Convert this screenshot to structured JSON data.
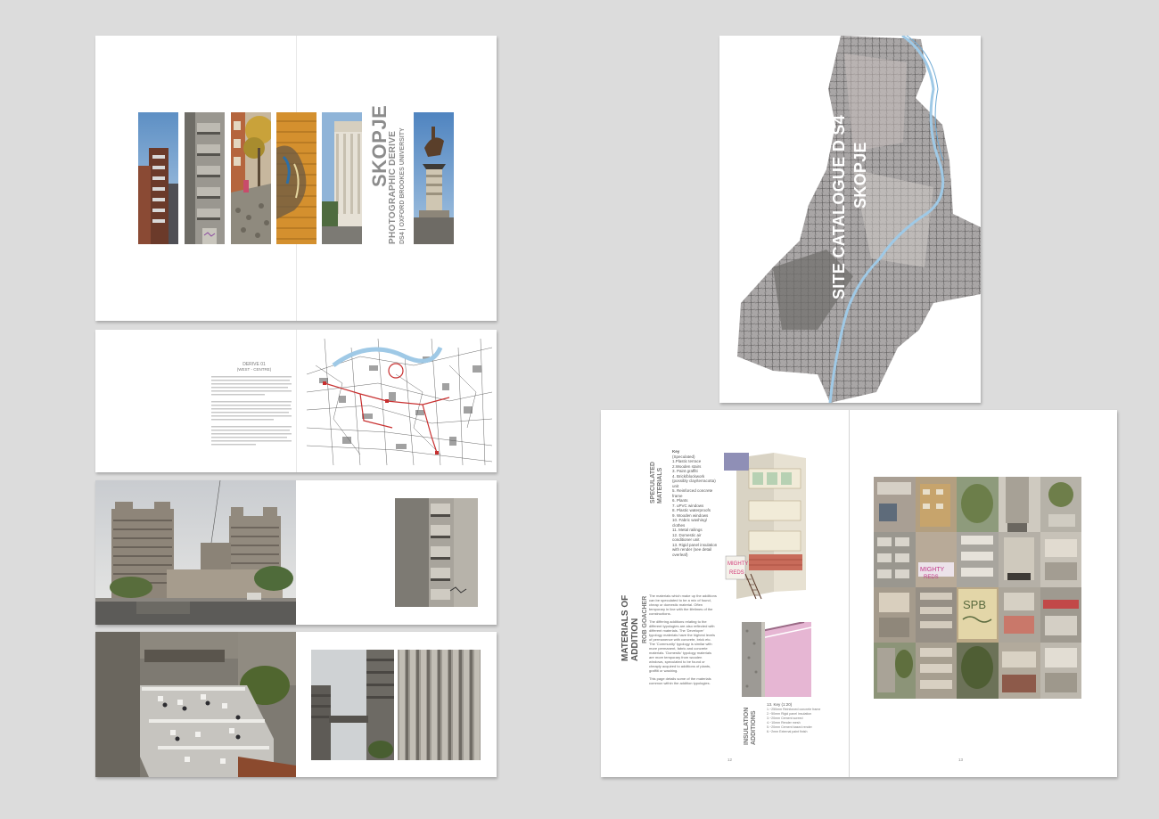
{
  "cover": {
    "title": "SKOPJE",
    "subtitle": "PHOTOGRAPHIC DERIVE",
    "tagline": "DS4 | OXFORD BROOKES UNIVERSITY"
  },
  "derive_page": {
    "heading": "DERIVE 01",
    "subheading": "(WEST - CENTRE)"
  },
  "catalogue": {
    "title_line1": "SITE CATALOGUE D S4",
    "title_line2": "SKOPJE"
  },
  "materials": {
    "title": "MATERIALS OF ADDITION",
    "author": "ROB GOACHER",
    "speculated_label": "SPECULATED MATERIALS",
    "insulation_label": "INSULATION ADDITIONS",
    "key_heading": "Key",
    "key_sub": "(Speculated)",
    "key_items": [
      "1.Plastic terrace",
      "2.Wooden stairs",
      "3. Paint graffiti",
      "4. Brick/blockwork",
      "(possibly clay/terracotta)",
      "unit",
      "5. Reinforced concrete",
      "frame",
      "6. Plants",
      "7. uPVC windows",
      "8. Plastic waterproofs",
      "9. Wooden windows",
      "10. Fabric washing/",
      "clothes",
      "11. Metal railings",
      "12. Domestic air",
      "conditioner unit",
      "13. Rigid panel insulation",
      "with render (see detail",
      "overleaf)"
    ],
    "body_1": "The materials which make up the additions can be speculated to be a mix of found, cheap or domestic material. Often temporary in line with the lifetimes of the constructions.",
    "body_2": "The differing additions relating to the different typologies are also reflected with different materials. The 'Developer' typology materials have the highest levels of permanence with concrete, brick etc. The 'Community' typology is similar with more permanent, fabric and concrete materials. 'Domestic' typology materials are more temporary from wooden windows, speculated to be found or cheaply acquired to additions of plants, graffiti or washing.",
    "body_3": "This page details some of the materials common within the addition typologies.",
    "key2_heading": "13. Key (1:20)",
    "key2_items": [
      "1.~250mm Reinforced concrete frame",
      "2.~50mm Rigid panel insulation",
      "3.~20mm Cement screed",
      "4.~10mm Render mesh",
      "5.~20mm Cement based render",
      "6.~2mm External paint finish"
    ],
    "page_left": "12",
    "page_right": "13"
  },
  "graffiti": {
    "tag1": "MIGHTY REDS",
    "tag2": "SPB"
  },
  "colors": {
    "background": "#dcdcdc",
    "river": "#9fc9e6",
    "title_grey": "#8c8c8c",
    "map_red": "#c83030"
  }
}
